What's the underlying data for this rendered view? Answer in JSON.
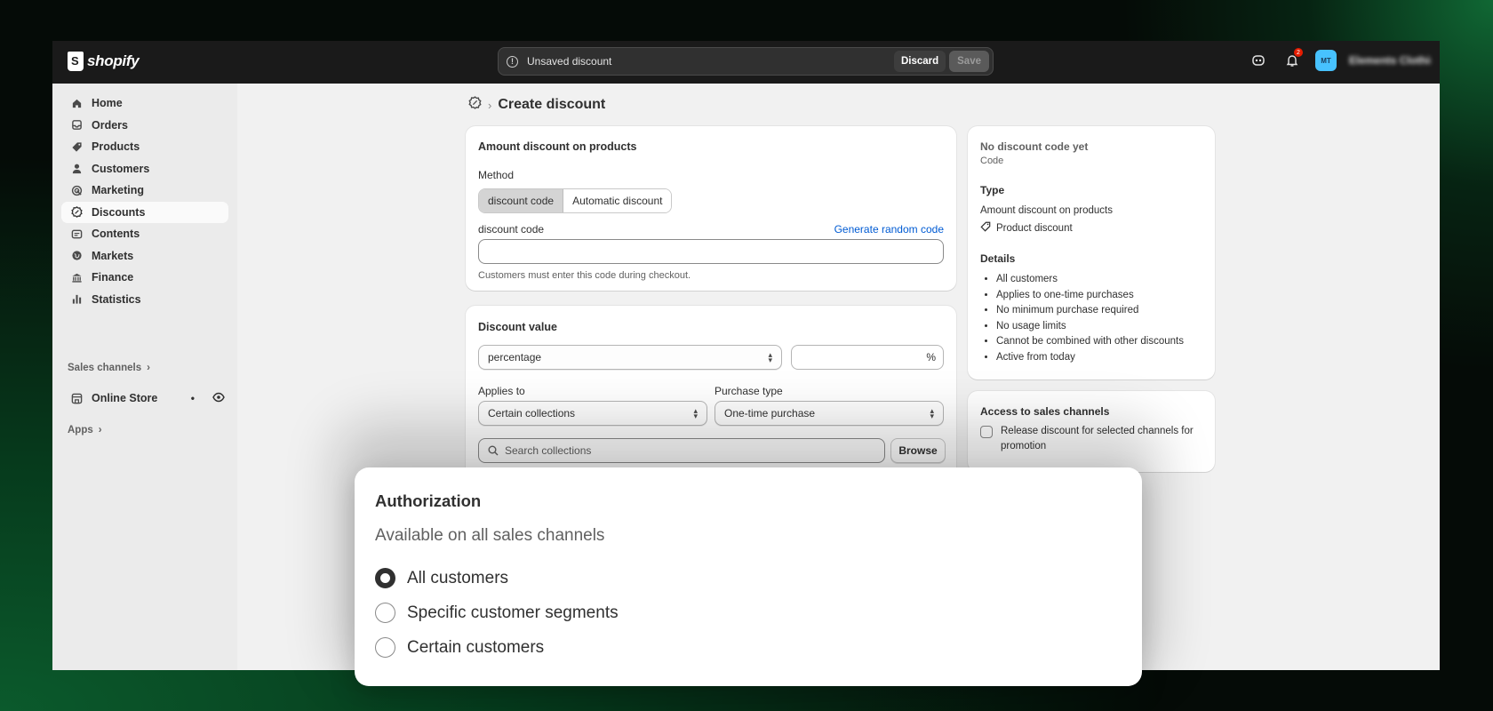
{
  "app": {
    "brand": "shopify"
  },
  "topbar": {
    "unsaved_text": "Unsaved discount",
    "discard_label": "Discard",
    "save_label": "Save",
    "notification_count": "2",
    "avatar_initials": "MT",
    "store_name": "Elements Clothing"
  },
  "sidebar": {
    "items": [
      {
        "label": "Home",
        "icon": "home-icon"
      },
      {
        "label": "Orders",
        "icon": "orders-icon"
      },
      {
        "label": "Products",
        "icon": "tag-icon"
      },
      {
        "label": "Customers",
        "icon": "person-icon"
      },
      {
        "label": "Marketing",
        "icon": "target-icon"
      },
      {
        "label": "Discounts",
        "icon": "discount-icon",
        "active": true
      },
      {
        "label": "Contents",
        "icon": "content-icon"
      },
      {
        "label": "Markets",
        "icon": "globe-icon"
      },
      {
        "label": "Finance",
        "icon": "bank-icon"
      },
      {
        "label": "Statistics",
        "icon": "bar-chart-icon"
      }
    ],
    "sales_channels_label": "Sales channels",
    "online_store_label": "Online Store",
    "apps_label": "Apps"
  },
  "page": {
    "title": "Create discount"
  },
  "method_card": {
    "title": "Amount discount on products",
    "method_label": "Method",
    "method_options": [
      "discount code",
      "Automatic discount"
    ],
    "selected_method": "discount code",
    "code_label": "discount code",
    "generate_label": "Generate random code",
    "code_value": "",
    "code_help": "Customers must enter this code during checkout."
  },
  "value_card": {
    "title": "Discount value",
    "value_type": "percentage",
    "value_amount": "",
    "value_suffix": "%",
    "applies_to_label": "Applies to",
    "applies_to_value": "Certain collections",
    "purchase_type_label": "Purchase type",
    "purchase_type_value": "One-time purchase",
    "search_placeholder": "Search collections",
    "browse_label": "Browse"
  },
  "summary_card": {
    "code_title": "No discount code yet",
    "code_sub": "Code",
    "type_heading": "Type",
    "type_value": "Amount discount on products",
    "type_tag": "Product discount",
    "details_heading": "Details",
    "details": [
      "All customers",
      "Applies to one-time purchases",
      "No minimum purchase required",
      "No usage limits",
      "Cannot be combined with other discounts",
      "Active from today"
    ]
  },
  "sales_channels_card": {
    "title": "Access to sales channels",
    "checkbox_label": "Release discount for selected channels for promotion",
    "checked": false
  },
  "authorization_panel": {
    "title": "Authorization",
    "subtitle": "Available on all sales channels",
    "options": [
      "All customers",
      "Specific customer segments",
      "Certain customers"
    ],
    "selected": "All customers"
  },
  "colors": {
    "topbar": "#1a1a1a",
    "link": "#005bd3",
    "background_glow": "#0b5a2c"
  }
}
